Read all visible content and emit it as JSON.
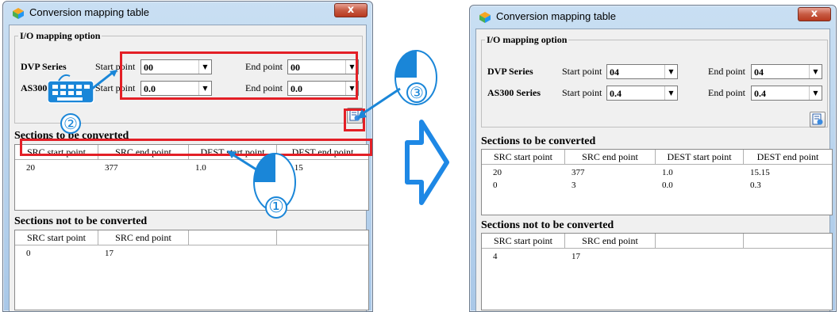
{
  "left_window": {
    "title": "Conversion mapping table",
    "close": "x",
    "io_group": {
      "legend": "I/O mapping option",
      "dvp_label": "DVP Series",
      "as300_label": "AS300 Series",
      "dvp_start_label": "Start point",
      "dvp_start_value": "00",
      "dvp_end_label": "End point",
      "dvp_end_value": "00",
      "as_start_label": "Start point",
      "as_start_value": "0.0",
      "as_end_label": "End point",
      "as_end_value": "0.0"
    },
    "sections_converted": {
      "title": "Sections to be converted",
      "headers": [
        "SRC start point",
        "SRC end point",
        "DEST start point",
        "DEST end point"
      ],
      "rows": [
        [
          "20",
          "377",
          "1.0",
          "15.15"
        ]
      ]
    },
    "sections_not_converted": {
      "title": "Sections not to be converted",
      "headers": [
        "SRC start point",
        "SRC end point",
        "",
        ""
      ],
      "rows": [
        [
          "0",
          "17"
        ]
      ]
    }
  },
  "right_window": {
    "title": "Conversion mapping table",
    "close": "x",
    "io_group": {
      "legend": "I/O mapping option",
      "dvp_label": "DVP Series",
      "as300_label": "AS300 Series",
      "dvp_start_label": "Start point",
      "dvp_start_value": "04",
      "dvp_end_label": "End point",
      "dvp_end_value": "04",
      "as_start_label": "Start point",
      "as_start_value": "0.4",
      "as_end_label": "End point",
      "as_end_value": "0.4"
    },
    "sections_converted": {
      "title": "Sections to be converted",
      "headers": [
        "SRC start point",
        "SRC end point",
        "DEST start point",
        "DEST end point"
      ],
      "rows": [
        [
          "20",
          "377",
          "1.0",
          "15.15"
        ],
        [
          "0",
          "3",
          "0.0",
          "0.3"
        ]
      ]
    },
    "sections_not_converted": {
      "title": "Sections not to be converted",
      "headers": [
        "SRC start point",
        "SRC end point",
        "",
        ""
      ],
      "rows": [
        [
          "4",
          "17"
        ]
      ]
    }
  },
  "annotations": {
    "step1": "①",
    "step2": "②",
    "step3": "③"
  },
  "colors": {
    "highlight": "#e31f26",
    "callout_blue": "#1a86d8",
    "arrow_blue": "#1e88e5"
  },
  "icons": [
    "app-icon",
    "close-icon",
    "dropdown-arrow-icon",
    "apply-mapping-icon",
    "mouse-icon",
    "keyboard-icon",
    "right-arrow-icon"
  ]
}
